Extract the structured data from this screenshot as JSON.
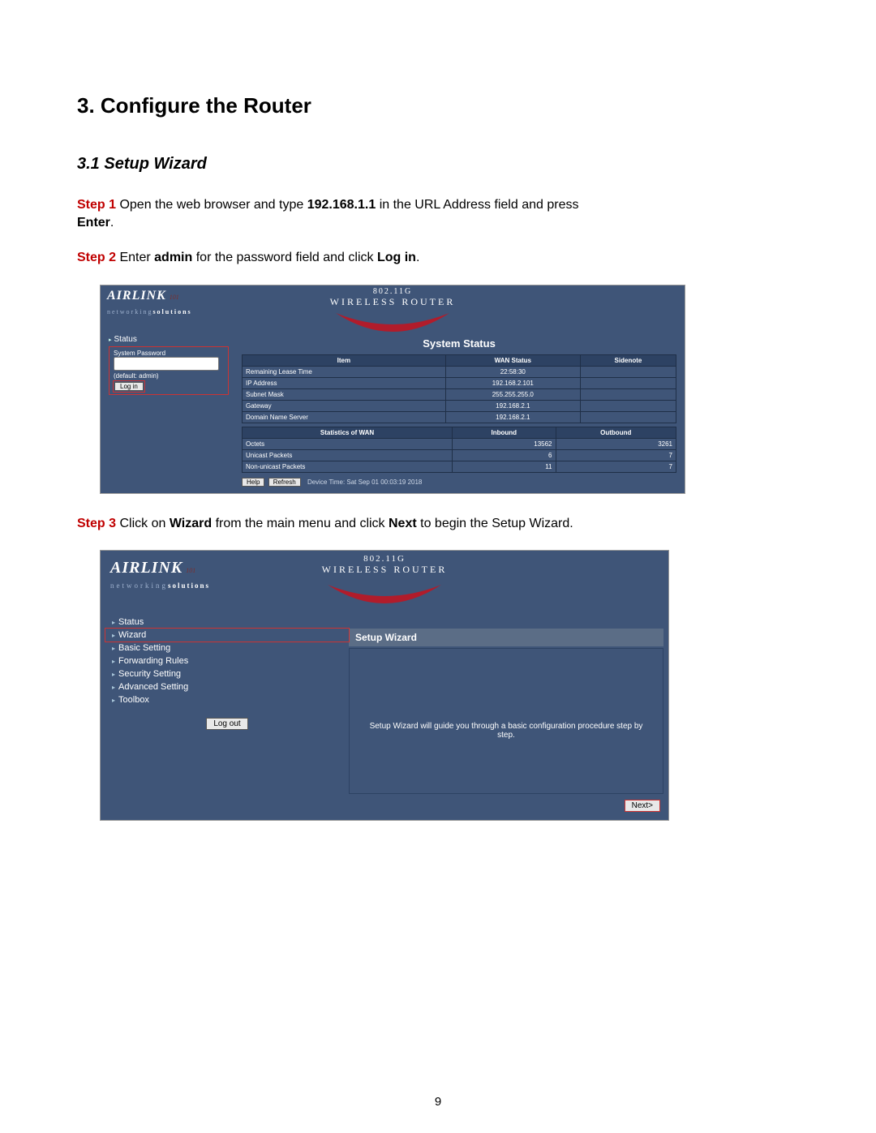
{
  "heading": "3. Configure the Router",
  "subheading": "3.1 Setup Wizard",
  "step1": {
    "label": "Step 1",
    "text_a": " Open the web browser and type ",
    "ip": "192.168.1.1",
    "text_b": " in the URL Address field and press ",
    "enter": "Enter",
    "tail": "."
  },
  "step2": {
    "label": "Step 2",
    "text_a": " Enter ",
    "admin": "admin",
    "text_b": " for the password field and click ",
    "login": "Log in",
    "tail": "."
  },
  "shot1": {
    "brand_big": "AIRLINK",
    "brand_small": "101",
    "brand_sols_a": "networking",
    "brand_sols_b": "solutions",
    "router_title1": "802.11G",
    "router_title2": "WIRELESS ROUTER",
    "nav_status": "Status",
    "syspwd_label": "System Password",
    "default_hint": "(default: admin)",
    "login_btn": "Log in",
    "content_title": "System Status",
    "table1_headers": [
      "Item",
      "WAN Status",
      "Sidenote"
    ],
    "table1_rows": [
      [
        "Remaining Lease Time",
        "22:58:30",
        ""
      ],
      [
        "IP Address",
        "192.168.2.101",
        ""
      ],
      [
        "Subnet Mask",
        "255.255.255.0",
        ""
      ],
      [
        "Gateway",
        "192.168.2.1",
        ""
      ],
      [
        "Domain Name Server",
        "192.168.2.1",
        ""
      ]
    ],
    "table2_headers": [
      "Statistics of WAN",
      "Inbound",
      "Outbound"
    ],
    "table2_rows": [
      [
        "Octets",
        "13562",
        "3261"
      ],
      [
        "Unicast Packets",
        "6",
        "7"
      ],
      [
        "Non-unicast Packets",
        "11",
        "7"
      ]
    ],
    "help_btn": "Help",
    "refresh_btn": "Refresh",
    "device_time": "Device Time: Sat Sep 01 00:03:19 2018"
  },
  "step3": {
    "label": "Step 3",
    "text_a": " Click on ",
    "wizard": "Wizard",
    "text_b": " from the main menu and click ",
    "next": "Next",
    "text_c": " to begin the Setup Wizard."
  },
  "shot2": {
    "brand_big": "AIRLINK",
    "brand_small": "101",
    "brand_sols_a": "networking",
    "brand_sols_b": "solutions",
    "router_title1": "802.11G",
    "router_title2": "WIRELESS ROUTER",
    "nav": {
      "status": "Status",
      "wizard": "Wizard",
      "basic": "Basic Setting",
      "forwarding": "Forwarding Rules",
      "security": "Security Setting",
      "advanced": "Advanced Setting",
      "toolbox": "Toolbox"
    },
    "logout_btn": "Log out",
    "panel_title": "Setup Wizard",
    "panel_msg": "Setup Wizard will guide you through a basic configuration procedure step by step.",
    "next_btn": "Next>"
  },
  "page_number": "9"
}
